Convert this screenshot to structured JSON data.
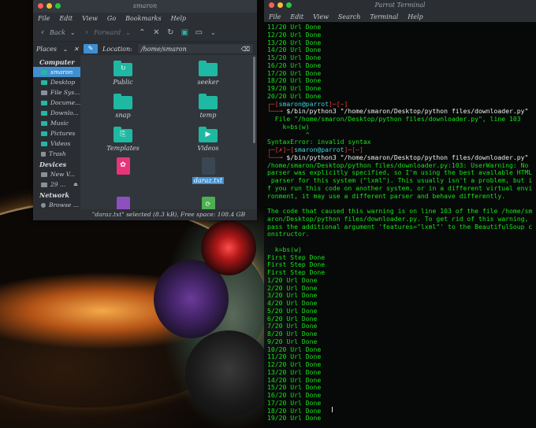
{
  "file_manager": {
    "title": "smaron",
    "menu": [
      "File",
      "Edit",
      "View",
      "Go",
      "Bookmarks",
      "Help"
    ],
    "toolbar": {
      "back_label": "Back",
      "forward_label": "Forward"
    },
    "places_label": "Places",
    "location_label": "Location:",
    "location_value": "/home/smaron",
    "sidebar": {
      "computer_head": "Computer",
      "computer_items": [
        "smaron",
        "Desktop",
        "File Sys...",
        "Docume...",
        "Downlo...",
        "Music",
        "Pictures",
        "Videos",
        "Trash"
      ],
      "devices_head": "Devices",
      "device_items": [
        "New V...",
        "29 ..."
      ],
      "network_head": "Network",
      "network_items": [
        "Browse ..."
      ]
    },
    "files": [
      {
        "name": "Public"
      },
      {
        "name": "seeker"
      },
      {
        "name": "snap"
      },
      {
        "name": "temp"
      },
      {
        "name": "Templates"
      },
      {
        "name": "Videos"
      },
      {
        "name": ""
      },
      {
        "name": "daraz.txt"
      },
      {
        "name": ""
      },
      {
        "name": ""
      }
    ],
    "status": "\"daraz.txt\" selected (8.3 kB), Free space: 108.4 GB"
  },
  "terminal": {
    "title": "Parrot Terminal",
    "menu": [
      "File",
      "Edit",
      "View",
      "Search",
      "Terminal",
      "Help"
    ],
    "lines": [
      "11/20 Url Done",
      "12/20 Url Done",
      "13/20 Url Done",
      "14/20 Url Done",
      "15/20 Url Done",
      "16/20 Url Done",
      "17/20 Url Done",
      "18/20 Url Done",
      "19/20 Url Done",
      "20/20 Url Done",
      "┌─[smaron@parrot]─[~]",
      "└──╼ $/bin/python3 \"/home/smaron/Desktop/python files/downloader.py\"",
      "  File \"/home/smaron/Desktop/python files/downloader.py\", line 103",
      "    k=bs(w)",
      "          ^",
      "SyntaxError: invalid syntax",
      "┌─[✗]─[smaron@parrot]─[~]",
      "└──╼ $/bin/python3 \"/home/smaron/Desktop/python files/downloader.py\"",
      "/home/smaron/Desktop/python files/downloader.py:103: UserWarning: No",
      "parser was explicitly specified, so I'm using the best available HTML",
      " parser for this system (\"lxml\"). This usually isn't a problem, but i",
      "f you run this code on another system, or in a different virtual envi",
      "ronment, it may use a different parser and behave differently.",
      "",
      "The code that caused this warning is on line 103 of the file /home/sm",
      "aron/Desktop/python files/downloader.py. To get rid of this warning,",
      "pass the additional argument 'features=\"lxml\"' to the BeautifulSoup c",
      "onstructor.",
      "",
      "  k=bs(w)",
      "First Step Done",
      "First Step Done",
      "First Step Done",
      "1/20 Url Done",
      "2/20 Url Done",
      "3/20 Url Done",
      "4/20 Url Done",
      "5/20 Url Done",
      "6/20 Url Done",
      "7/20 Url Done",
      "8/20 Url Done",
      "9/20 Url Done",
      "10/20 Url Done",
      "11/20 Url Done",
      "12/20 Url Done",
      "13/20 Url Done",
      "14/20 Url Done",
      "15/20 Url Done",
      "16/20 Url Done",
      "17/20 Url Done",
      "18/20 Url Done",
      "19/20 Url Done"
    ]
  },
  "colors": {
    "accent": "#3f8fd1",
    "folder": "#1fb8a2",
    "terminal_text": "#16e316",
    "prompt_red": "#e23a2a",
    "prompt_cyan": "#3fd0d6",
    "close_dot": "#ff5f57",
    "min_dot": "#febc2e",
    "max_dot": "#28c840"
  }
}
